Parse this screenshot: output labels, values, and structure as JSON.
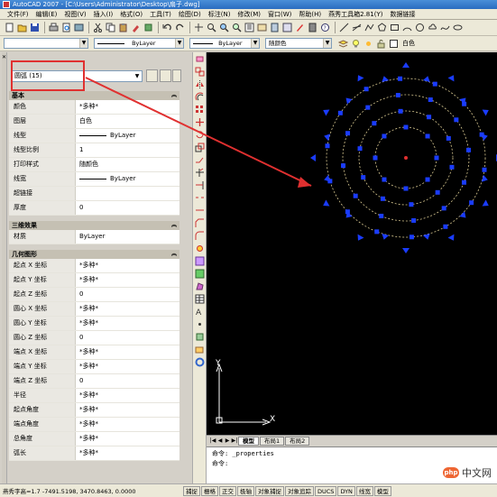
{
  "window": {
    "title": "AutoCAD 2007 - [C:\\Users\\Administrator\\Desktop\\扇子.dwg]"
  },
  "menu": [
    {
      "label": "文件(F)"
    },
    {
      "label": "编辑(E)"
    },
    {
      "label": "视图(V)"
    },
    {
      "label": "插入(I)"
    },
    {
      "label": "格式(O)"
    },
    {
      "label": "工具(T)"
    },
    {
      "label": "绘图(D)"
    },
    {
      "label": "标注(N)"
    },
    {
      "label": "修改(M)"
    },
    {
      "label": "窗口(W)"
    },
    {
      "label": "帮助(H)"
    },
    {
      "label": "燕秀工具箱2.81(Y)"
    },
    {
      "label": "数据链接"
    }
  ],
  "layer_toolbar": {
    "linetype_value": "ByLayer",
    "lineweight_value": "ByLayer",
    "color_value": "随颜色",
    "layer_value": "白色"
  },
  "properties": {
    "selection_label": "圆弧 (15)",
    "sections": {
      "basic": {
        "title": "基本",
        "rows": [
          {
            "key": "颜色",
            "value": "*多种*"
          },
          {
            "key": "图层",
            "value": "白色"
          },
          {
            "key": "线型",
            "value": "ByLayer"
          },
          {
            "key": "线型比例",
            "value": "1"
          },
          {
            "key": "打印样式",
            "value": "随颜色"
          },
          {
            "key": "线宽",
            "value": "ByLayer"
          },
          {
            "key": "超链接",
            "value": ""
          },
          {
            "key": "厚度",
            "value": "0"
          }
        ]
      },
      "three_d": {
        "title": "三维效果",
        "rows": [
          {
            "key": "材质",
            "value": "ByLayer"
          }
        ]
      },
      "geometry": {
        "title": "几何图形",
        "rows": [
          {
            "key": "起点 X 坐标",
            "value": "*多种*"
          },
          {
            "key": "起点 Y 坐标",
            "value": "*多种*"
          },
          {
            "key": "起点 Z 坐标",
            "value": "0"
          },
          {
            "key": "圆心 X 坐标",
            "value": "*多种*"
          },
          {
            "key": "圆心 Y 坐标",
            "value": "*多种*"
          },
          {
            "key": "圆心 Z 坐标",
            "value": "0"
          },
          {
            "key": "端点 X 坐标",
            "value": "*多种*"
          },
          {
            "key": "端点 Y 坐标",
            "value": "*多种*"
          },
          {
            "key": "端点 Z 坐标",
            "value": "0"
          },
          {
            "key": "半径",
            "value": "*多种*"
          },
          {
            "key": "起点角度",
            "value": "*多种*"
          },
          {
            "key": "端点角度",
            "value": "*多种*"
          },
          {
            "key": "总角度",
            "value": "*多种*"
          },
          {
            "key": "弧长",
            "value": "*多种*"
          }
        ]
      }
    }
  },
  "ucs": {
    "x_label": "X",
    "y_label": "Y"
  },
  "layout_tabs": [
    {
      "label": "模型"
    },
    {
      "label": "布局1"
    },
    {
      "label": "布局2"
    }
  ],
  "command": {
    "line1": "命令: _properties",
    "line2": "命令:"
  },
  "status": {
    "coords": "燕秀字高=1.7  -7491.5198, 3470.8463, 0.0000",
    "buttons": [
      "捕捉",
      "栅格",
      "正交",
      "极轴",
      "对象捕捉",
      "对象追踪",
      "DUCS",
      "DYN",
      "线宽",
      "模型"
    ]
  },
  "watermark": {
    "logo": "php",
    "text": "中文网"
  },
  "colors": {
    "grip_blue": "#1a3cff",
    "arrow_red": "#e03030",
    "dashed_arc": "#d8c890"
  }
}
